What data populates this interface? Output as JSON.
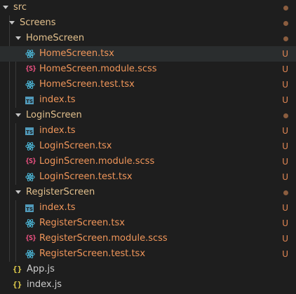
{
  "colors": {
    "folder_text": "#e2c08d",
    "untracked_text": "#f0965a",
    "plain_text": "#cccccc",
    "status_untracked": "#e48855",
    "dot": "#8b5d3f",
    "react_icon": "#4fc3e6",
    "scss_icon": "#f55385",
    "ts_icon": "#519aba",
    "js_icon": "#e8d44d"
  },
  "tree": [
    {
      "kind": "folder",
      "icon": "chevron-down-icon",
      "label": "src",
      "dot": true
    },
    {
      "kind": "folder",
      "icon": "chevron-down-icon",
      "label": "Screens",
      "dot": true
    },
    {
      "kind": "folder",
      "icon": "chevron-down-icon",
      "label": "HomeScreen",
      "dot": true
    },
    {
      "kind": "file",
      "icon": "react-icon",
      "label": "HomeScreen.tsx",
      "status": "U",
      "selected": true
    },
    {
      "kind": "file",
      "icon": "scss-icon",
      "label": "HomeScreen.module.scss",
      "status": "U"
    },
    {
      "kind": "file",
      "icon": "react-icon",
      "label": "HomeScreen.test.tsx",
      "status": "U"
    },
    {
      "kind": "file",
      "icon": "typescript-icon",
      "label": "index.ts",
      "status": "U"
    },
    {
      "kind": "folder",
      "icon": "chevron-down-icon",
      "label": "LoginScreen",
      "dot": true
    },
    {
      "kind": "file",
      "icon": "typescript-icon",
      "label": "index.ts",
      "status": "U"
    },
    {
      "kind": "file",
      "icon": "react-icon",
      "label": "LoginScreen.tsx",
      "status": "U"
    },
    {
      "kind": "file",
      "icon": "scss-icon",
      "label": "LoginScreen.module.scss",
      "status": "U"
    },
    {
      "kind": "file",
      "icon": "react-icon",
      "label": "LoginScreen.test.tsx",
      "status": "U"
    },
    {
      "kind": "folder",
      "icon": "chevron-down-icon",
      "label": "RegisterScreen",
      "dot": true
    },
    {
      "kind": "file",
      "icon": "typescript-icon",
      "label": "index.ts",
      "status": "U"
    },
    {
      "kind": "file",
      "icon": "react-icon",
      "label": "RegisterScreen.tsx",
      "status": "U"
    },
    {
      "kind": "file",
      "icon": "scss-icon",
      "label": "RegisterScreen.module.scss",
      "status": "U"
    },
    {
      "kind": "file",
      "icon": "react-icon",
      "label": "RegisterScreen.test.tsx",
      "status": "U"
    },
    {
      "kind": "file",
      "icon": "javascript-icon",
      "label": "App.js",
      "plain": true
    },
    {
      "kind": "file",
      "icon": "javascript-icon",
      "label": "index.js",
      "plain": true
    }
  ],
  "icon_glyphs": {
    "scss": "{S}",
    "js": "{}",
    "ts": "TS"
  }
}
